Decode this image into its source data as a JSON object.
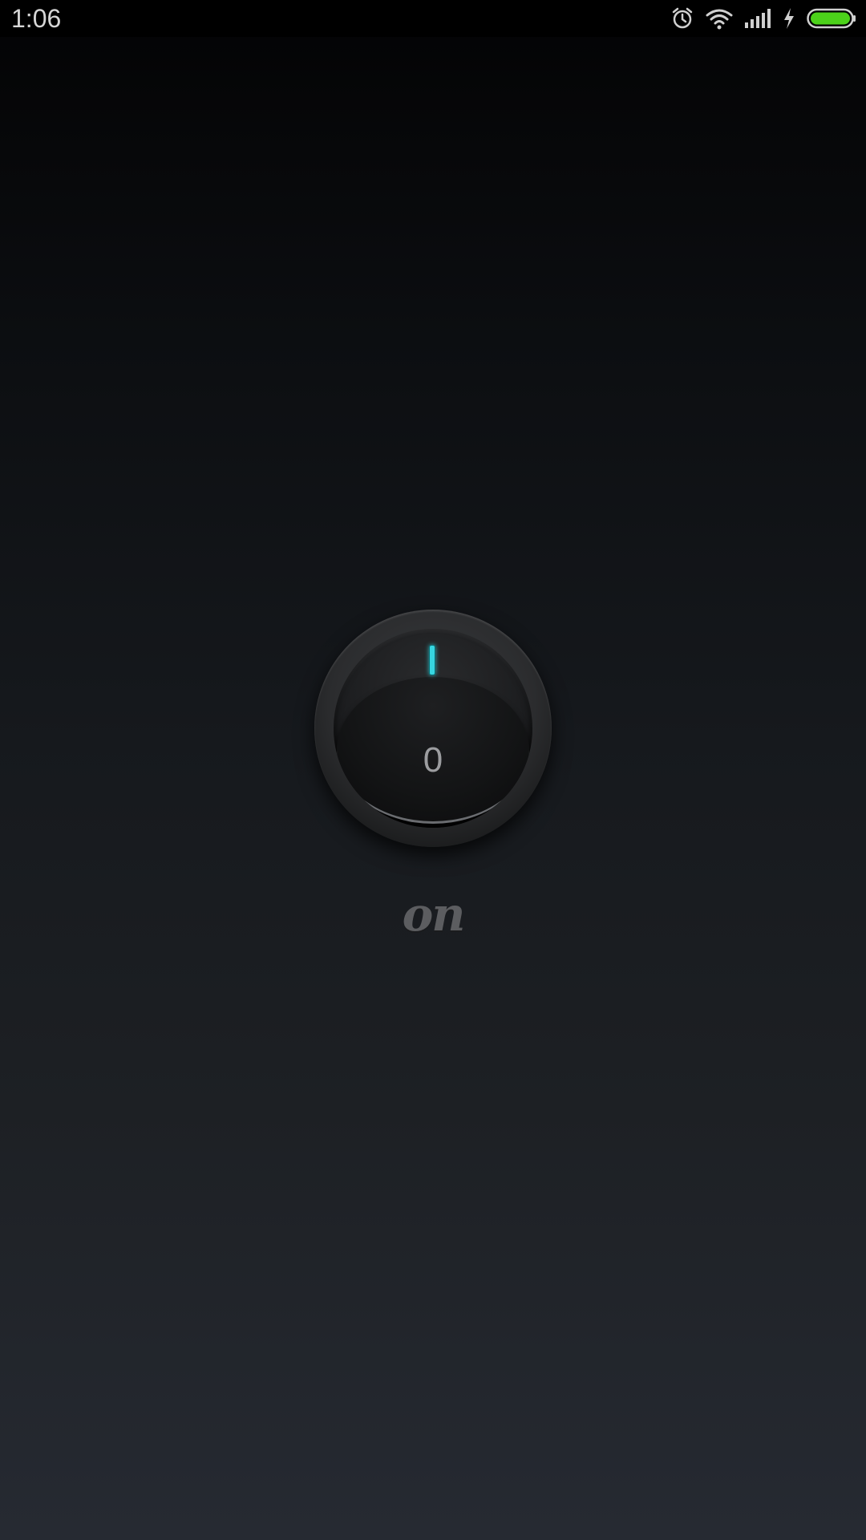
{
  "status_bar": {
    "time": "1:06",
    "icons": [
      "alarm-icon",
      "wifi-icon",
      "signal-icon",
      "charging-icon",
      "battery-icon"
    ],
    "battery_color": "#4cd21a"
  },
  "knob": {
    "on_mark": "I",
    "off_mark": "0",
    "indicator_color": "#37d6e0"
  },
  "state_label": "on"
}
